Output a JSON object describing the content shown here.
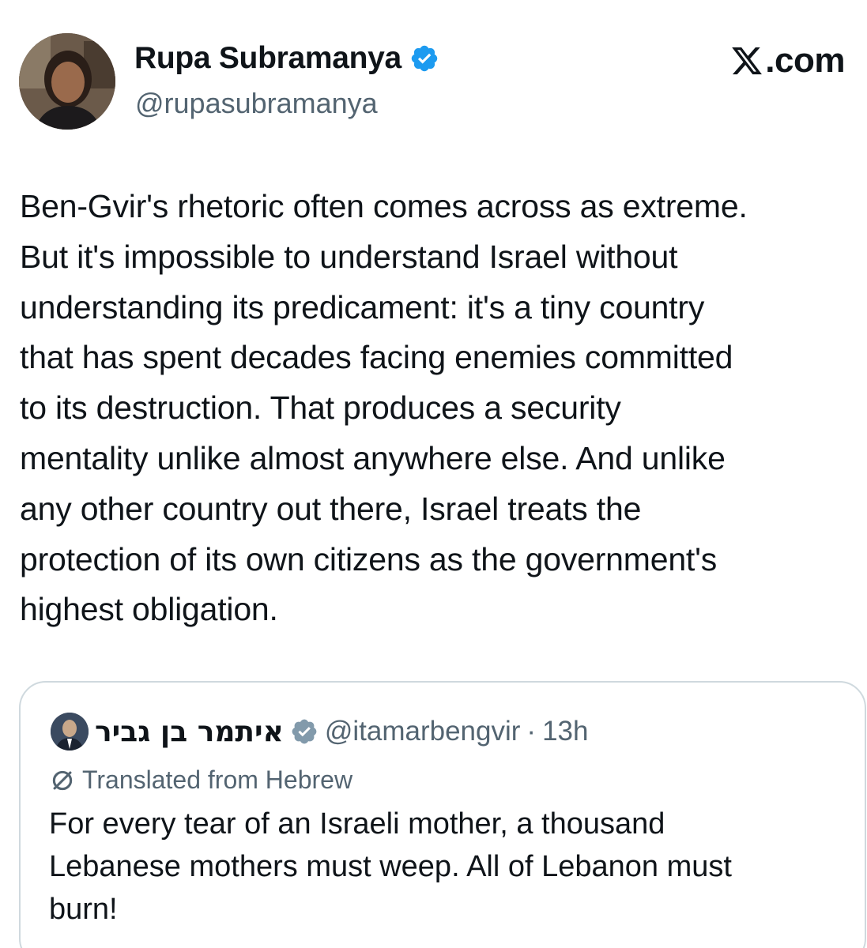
{
  "author": {
    "display_name": "Rupa Subramanya",
    "handle": "@rupasubramanya",
    "verified": true
  },
  "brand": {
    "site": ".com",
    "logo_icon": "x-logo-icon"
  },
  "tweet": {
    "text": "Ben-Gvir's rhetoric often comes across as extreme.\nBut it's impossible to understand Israel without\nunderstanding its predicament: it's a tiny country\nthat has spent decades facing enemies committed\nto its destruction. That produces a security\nmentality unlike almost anywhere else. And unlike\nany other country out there, Israel treats the\nprotection of its own citizens as the government's\nhighest obligation."
  },
  "quoted_tweet": {
    "display_name": "איתמר בן גביר",
    "handle": "@itamarbengvir",
    "separator": "·",
    "time": "13h",
    "verified": true,
    "translation_label": "Translated from Hebrew",
    "text": "For every tear of an Israeli mother, a thousand\nLebanese mothers must weep. All of Lebanon must\nburn!"
  },
  "colors": {
    "text": "#0f1419",
    "secondary_text": "#536471",
    "verified_blue": "#1d9bf0",
    "border": "#cfd9de"
  }
}
